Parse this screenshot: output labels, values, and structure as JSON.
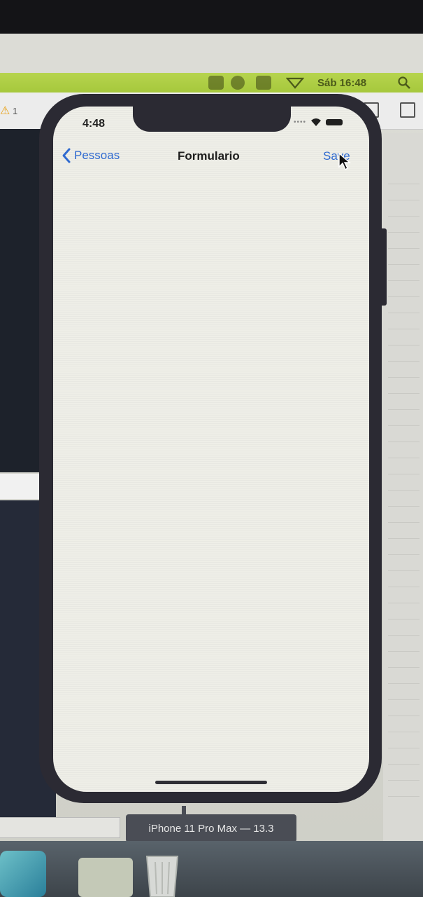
{
  "menubar": {
    "clock": "Sáb 16:48"
  },
  "xcode": {
    "warning_count": "1"
  },
  "status_bar": {
    "time": "4:48"
  },
  "navigation": {
    "back_label": "Pessoas",
    "title": "Formulario",
    "save_label": "Save"
  },
  "simulator": {
    "device_label": "iPhone 11 Pro Max — 13.3"
  },
  "colors": {
    "ios_blue": "#2f6ad0",
    "menubar_green": "#a6c83c",
    "phone_frame": "#2b2a33",
    "screen_bg": "#eeeee7"
  },
  "icons": [
    "chevron-left-icon",
    "cursor-icon",
    "wifi-icon",
    "battery-icon",
    "search-icon",
    "trash-icon",
    "warning-icon"
  ]
}
